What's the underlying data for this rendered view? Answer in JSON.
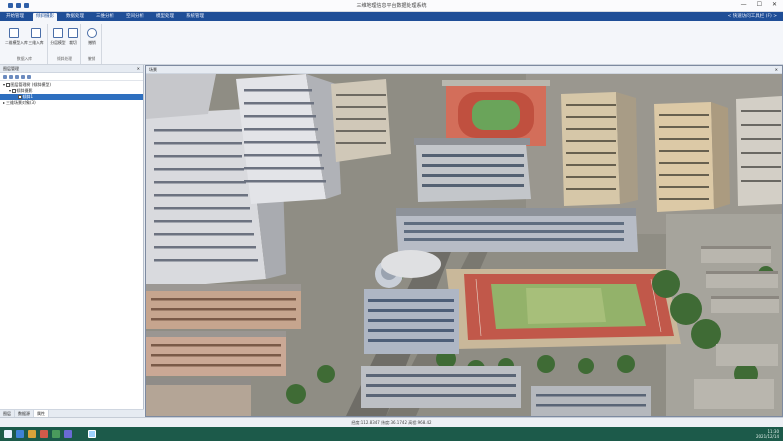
{
  "window": {
    "title": "三维地理信息平台数据处理系统",
    "controls": [
      "—",
      "☐",
      "✕"
    ]
  },
  "menu": {
    "tabs": [
      "开始管理",
      "倾斜摄影",
      "数据处理",
      "三维分析",
      "空间分析",
      "模型处理",
      "系统管理"
    ],
    "active_index": 1,
    "right_text": "< 快速访问工具栏 (F) >"
  },
  "ribbon": {
    "groups": [
      {
        "name": "数据入库",
        "buttons": [
          "二维模型入库",
          "三维入库"
        ]
      },
      {
        "name": "倾斜处理",
        "buttons": [
          "分层模型",
          "裁切"
        ]
      },
      {
        "name": "撤销",
        "buttons": [
          "撤销"
        ]
      }
    ]
  },
  "left_panel": {
    "title": "图层管理",
    "close": "✕",
    "tree": [
      {
        "label": "图层管理树 (倾斜模型)",
        "level": 0,
        "expanded": true,
        "checked": true,
        "selected": false
      },
      {
        "label": "倾斜摄影",
        "level": 1,
        "expanded": true,
        "checked": true,
        "selected": false
      },
      {
        "label": "倾斜1",
        "level": 2,
        "expanded": false,
        "checked": true,
        "selected": true
      },
      {
        "label": "三维场景对象(3)",
        "level": 0,
        "expanded": false,
        "checked": false,
        "selected": false
      }
    ],
    "bottom_tabs": [
      "图层",
      "数据源",
      "属性"
    ],
    "active_bottom_index": 2
  },
  "viewer": {
    "tab_label": "场景",
    "close": "✕"
  },
  "status": {
    "text": "经度:112.8347 纬度:36.1742 高程:968.42"
  },
  "taskbar": {
    "time": "11:30",
    "date": "2021/12/14"
  },
  "colors": {
    "menu_bg": "#1f4e97",
    "taskbar_bg": "#1c5a4a",
    "selection": "#2e6fbf",
    "track_red": "#c3574a",
    "field_green": "#7fa65a"
  }
}
